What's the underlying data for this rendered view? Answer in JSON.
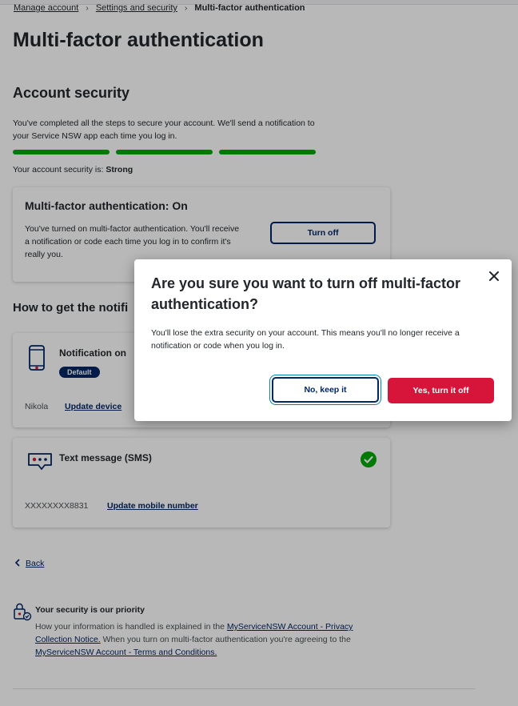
{
  "breadcrumb": {
    "items": [
      "Manage account",
      "Settings and security"
    ],
    "current": "Multi-factor authentication"
  },
  "page_title": "Multi-factor authentication",
  "account_security": {
    "title": "Account security",
    "description": "You've completed all the steps to secure your account. We'll send a notification to your Service NSW app each time you log in.",
    "strength_label": "Your account security is:",
    "strength_value": "Strong",
    "strength_steps_completed": 3,
    "strength_steps_total": 3,
    "strength_color": "#00a908"
  },
  "mfa_card": {
    "title": "Multi-factor authentication: On",
    "description": "You've turned on multi-factor authentication. You'll receive a notification or code each time you log in to confirm it's really you.",
    "turn_off_label": "Turn off"
  },
  "how_section": {
    "title": "How to get the notifi"
  },
  "methods": [
    {
      "title": "Notification on",
      "badge": "Default",
      "value": "Nikola",
      "link": "Update device",
      "icon": "phone-icon"
    },
    {
      "title": "Text message (SMS)",
      "value": "XXXXXXXX8831",
      "link": "Update mobile number",
      "icon": "sms-icon",
      "status_icon": "check-icon"
    }
  ],
  "back_label": "Back",
  "priority": {
    "title": "Your security is our priority",
    "text_1": "How your information is handled is explained in the ",
    "link_1": "MyServiceNSW Account - Privacy Collection Notice.",
    "text_2": " When you turn on multi-factor authentication you're agreeing to the ",
    "link_2": "MyServiceNSW Account - Terms and Conditions."
  },
  "modal": {
    "title": "Are you sure you want to turn off multi-factor authentication?",
    "body": "You'll lose the extra security on your account. This means you'll no longer receive a notification or code when you log in.",
    "cancel_label": "No, keep it",
    "confirm_label": "Yes, turn it off",
    "confirm_color": "#d7153a"
  },
  "colors": {
    "primary": "#002664",
    "success": "#00a908",
    "danger": "#d7153a"
  }
}
